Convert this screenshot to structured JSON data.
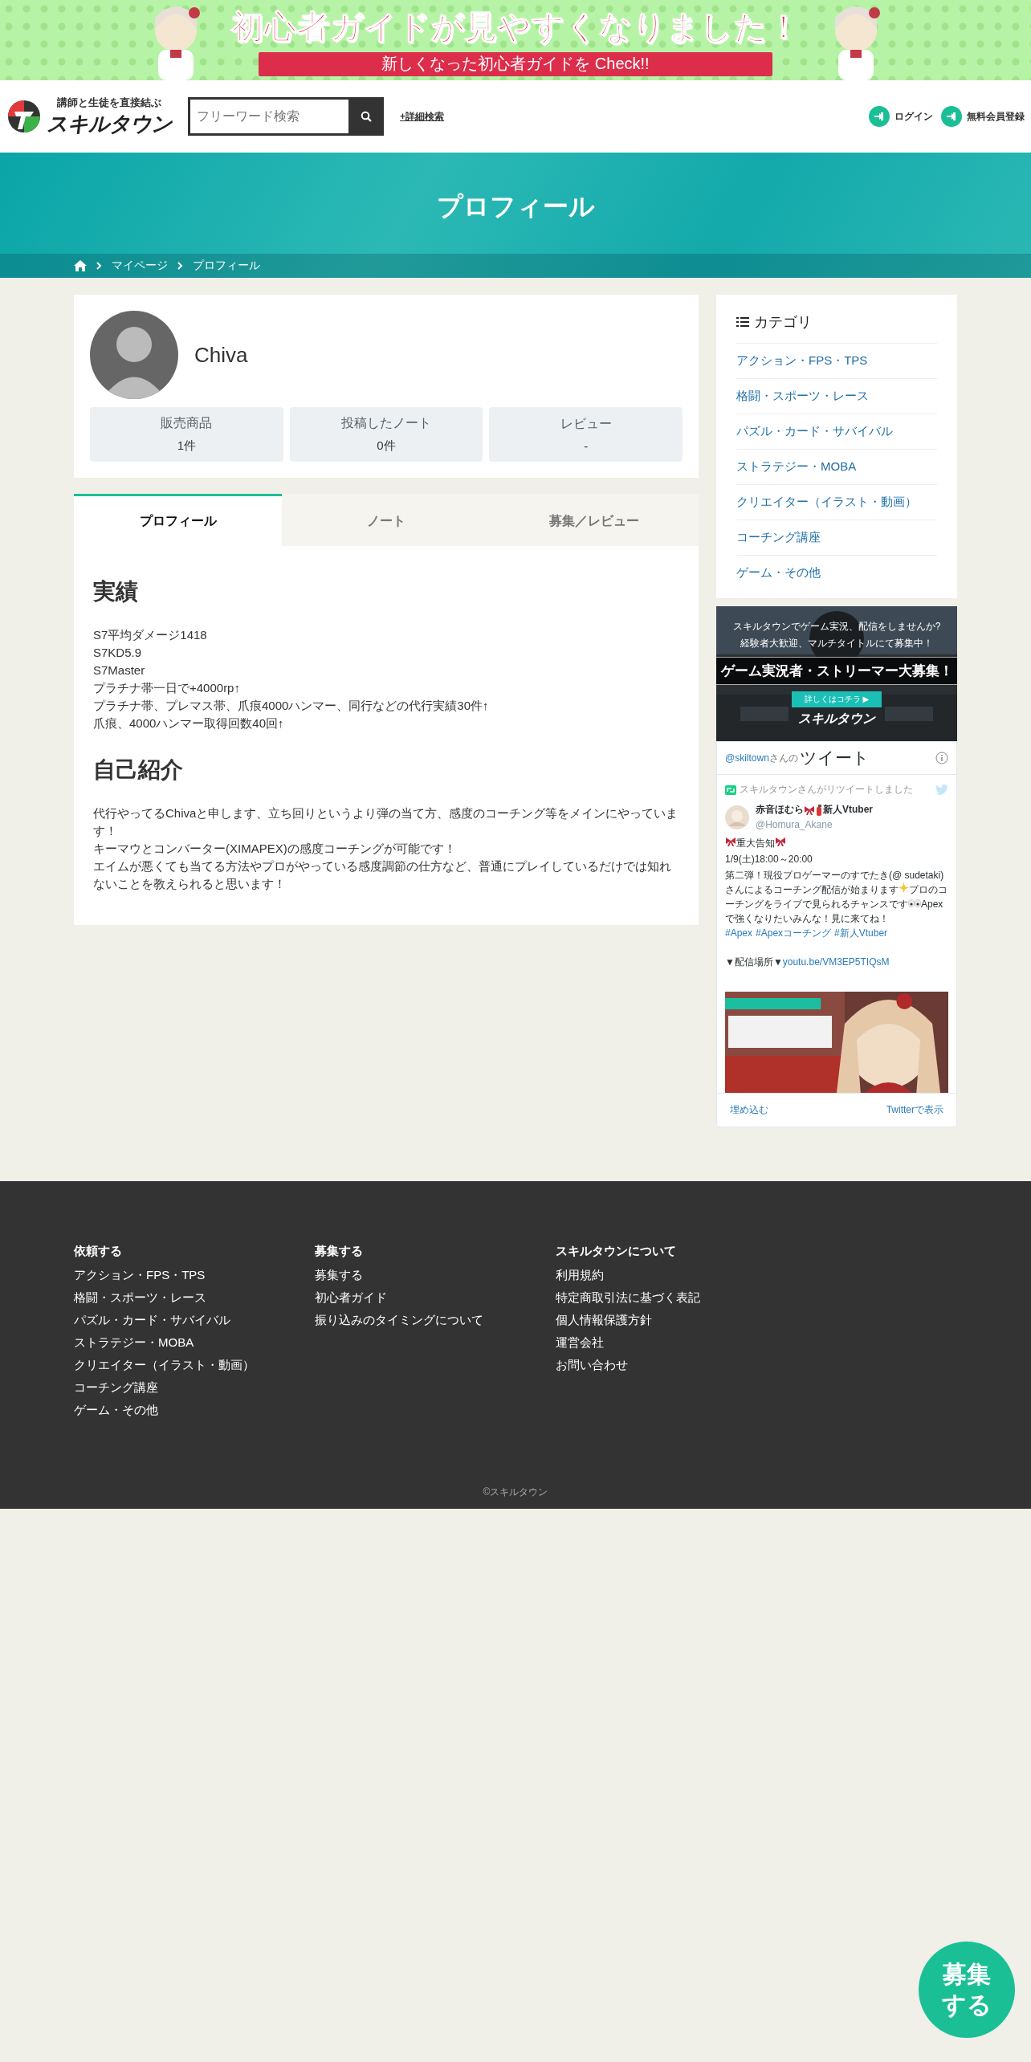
{
  "promo_banner": {
    "title": "初心者ガイドが見やすくなりました！",
    "subtitle": "新しくなった初心者ガイドを Check!!"
  },
  "header": {
    "tagline": "講師と生徒を直接結ぶ",
    "logo": "スキルタウン",
    "search": {
      "placeholder": "フリーワード検索"
    },
    "advanced_search": "+詳細検索",
    "actions": [
      "ログイン",
      "無料会員登録"
    ]
  },
  "hero": {
    "title": "プロフィール",
    "breadcrumbs": [
      "マイページ",
      "プロフィール"
    ]
  },
  "profile": {
    "name": "Chiva",
    "stats": [
      {
        "label": "販売商品",
        "value": "1件"
      },
      {
        "label": "投稿したノート",
        "value": "0件"
      },
      {
        "label": "レビュー",
        "value": "-"
      }
    ]
  },
  "tabs": [
    {
      "label": "プロフィール",
      "selected": true
    },
    {
      "label": "ノート",
      "selected": false
    },
    {
      "label": "募集／レビュー",
      "selected": false
    }
  ],
  "sections": [
    {
      "heading": "実績",
      "lines": [
        "S7平均ダメージ1418",
        "S7KD5.9",
        "S7Master",
        "プラチナ帯一日で+4000rp↑",
        "プラチナ帯、プレマス帯、爪痕4000ハンマー、同行などの代行実績30件↑",
        "爪痕、4000ハンマー取得回数40回↑"
      ]
    },
    {
      "heading": "自己紹介",
      "lines": [
        "代行やってるChivaと申します、立ち回りというより弾の当て方、感度のコーチング等をメインにやっています！",
        "キーマウとコンバーター(XIMAPEX)の感度コーチングが可能です！",
        "エイムが悪くても当てる方法やプロがやっている感度調節の仕方など、普通にプレイしているだけでは知れないことを教えられると思います！"
      ]
    }
  ],
  "sidebar": {
    "heading": "カテゴリ",
    "categories": [
      "アクション・FPS・TPS",
      "格闘・スポーツ・レース",
      "パズル・カード・サバイバル",
      "ストラテジー・MOBA",
      "クリエイター（イラスト・動画）",
      "コーチング講座",
      "ゲーム・その他"
    ],
    "ad": {
      "lines": [
        "スキルタウンでゲーム実況、配信をしませんか?",
        "経験者大歓迎、マルチタイトルにて募集中！"
      ],
      "headline": "ゲーム実況者・ストリーマー大募集！",
      "button": "詳しくはコチラ ▶",
      "logo": "スキルタウン"
    }
  },
  "twitter": {
    "account": "@skiltown",
    "account_suffix": "さんの",
    "title": "ツイート",
    "retweet_note": "スキルタウンさんがリツイートしました",
    "author": {
      "name_parts": [
        {
          "kind": "text",
          "text": "赤音ほむら"
        },
        {
          "kind": "ribbon"
        },
        {
          "kind": "extinguisher"
        },
        {
          "kind": "text",
          "text": "新人Vtuber"
        }
      ],
      "handle": "@Homura_Akane"
    },
    "body": [
      [
        {
          "kind": "ribbon"
        },
        {
          "kind": "text",
          "text": "重大告知"
        },
        {
          "kind": "ribbon"
        }
      ],
      [
        {
          "kind": "text",
          "text": "1/9(土)18:00～20:00"
        }
      ],
      [
        {
          "kind": "text",
          "text": "第二弾！現役プロゲーマーのすでたき(@ sudetaki)さんによるコーチング配信が始まります"
        },
        {
          "kind": "sparkle"
        },
        {
          "kind": "text",
          "text": "プロのコーチングをライブで見られるチャンスです"
        },
        {
          "kind": "eyes"
        },
        {
          "kind": "text",
          "text": "Apexで強くなりたいみんな！見に来てね！"
        },
        {
          "kind": "link",
          "text": "#Apex"
        },
        {
          "kind": "link",
          "text": "#Apexコーチング"
        },
        {
          "kind": "link",
          "text": "#新人Vtuber"
        }
      ],
      [
        {
          "kind": "text",
          "text": "▼配信場所▼"
        },
        {
          "kind": "link",
          "text": "youtu.be/VM3EP5TIQsM"
        }
      ]
    ],
    "footer_links": [
      "埋め込む",
      "Twitterで表示"
    ]
  },
  "footer": {
    "columns": [
      {
        "heading": "依頼する",
        "links": [
          "アクション・FPS・TPS",
          "格闘・スポーツ・レース",
          "パズル・カード・サバイバル",
          "ストラテジー・MOBA",
          "クリエイター（イラスト・動画）",
          "コーチング講座",
          "ゲーム・その他"
        ]
      },
      {
        "heading": "募集する",
        "links": [
          "募集する",
          "初心者ガイド",
          "振り込みのタイミングについて"
        ]
      },
      {
        "heading": "スキルタウンについて",
        "links": [
          "利用規約",
          "特定商取引法に基づく表記",
          "個人情報保護方針",
          "運営会社",
          "お問い合わせ"
        ]
      }
    ],
    "copyright": "©スキルタウン"
  },
  "floating_button": "募集する"
}
